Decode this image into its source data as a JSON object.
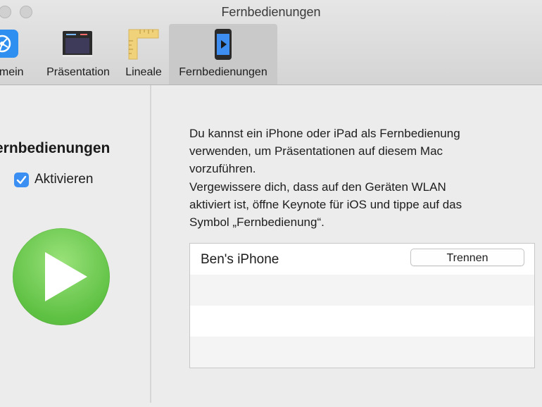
{
  "window": {
    "title": "Fernbedienungen"
  },
  "toolbar": {
    "tabs": [
      {
        "label": "emein",
        "icon": "gear-icon"
      },
      {
        "label": "Präsentation",
        "icon": "presentation-icon"
      },
      {
        "label": "Lineale",
        "icon": "ruler-icon"
      },
      {
        "label": "Fernbedienungen",
        "icon": "iphone-remote-icon",
        "selected": true
      }
    ]
  },
  "sidebar": {
    "heading": "ernbedienungen",
    "enable_label": "Aktivieren",
    "enable_checked": true,
    "icon": "play-icon"
  },
  "main": {
    "description_lines": [
      "Du kannst ein iPhone oder iPad als Fernbedienung",
      "verwenden, um Präsentationen auf diesem Mac",
      "vorzuführen.",
      "Vergewissere dich, dass auf den Geräten WLAN",
      "aktiviert ist, öffne Keynote für iOS und tippe auf das",
      "Symbol „Fernbedienung“."
    ],
    "devices": [
      {
        "name": "Ben's iPhone",
        "action_label": "Trennen"
      }
    ]
  },
  "colors": {
    "accent": "#3b8ff2",
    "play_green": "#5fc144",
    "selected_tab": "#c9c9c9"
  }
}
